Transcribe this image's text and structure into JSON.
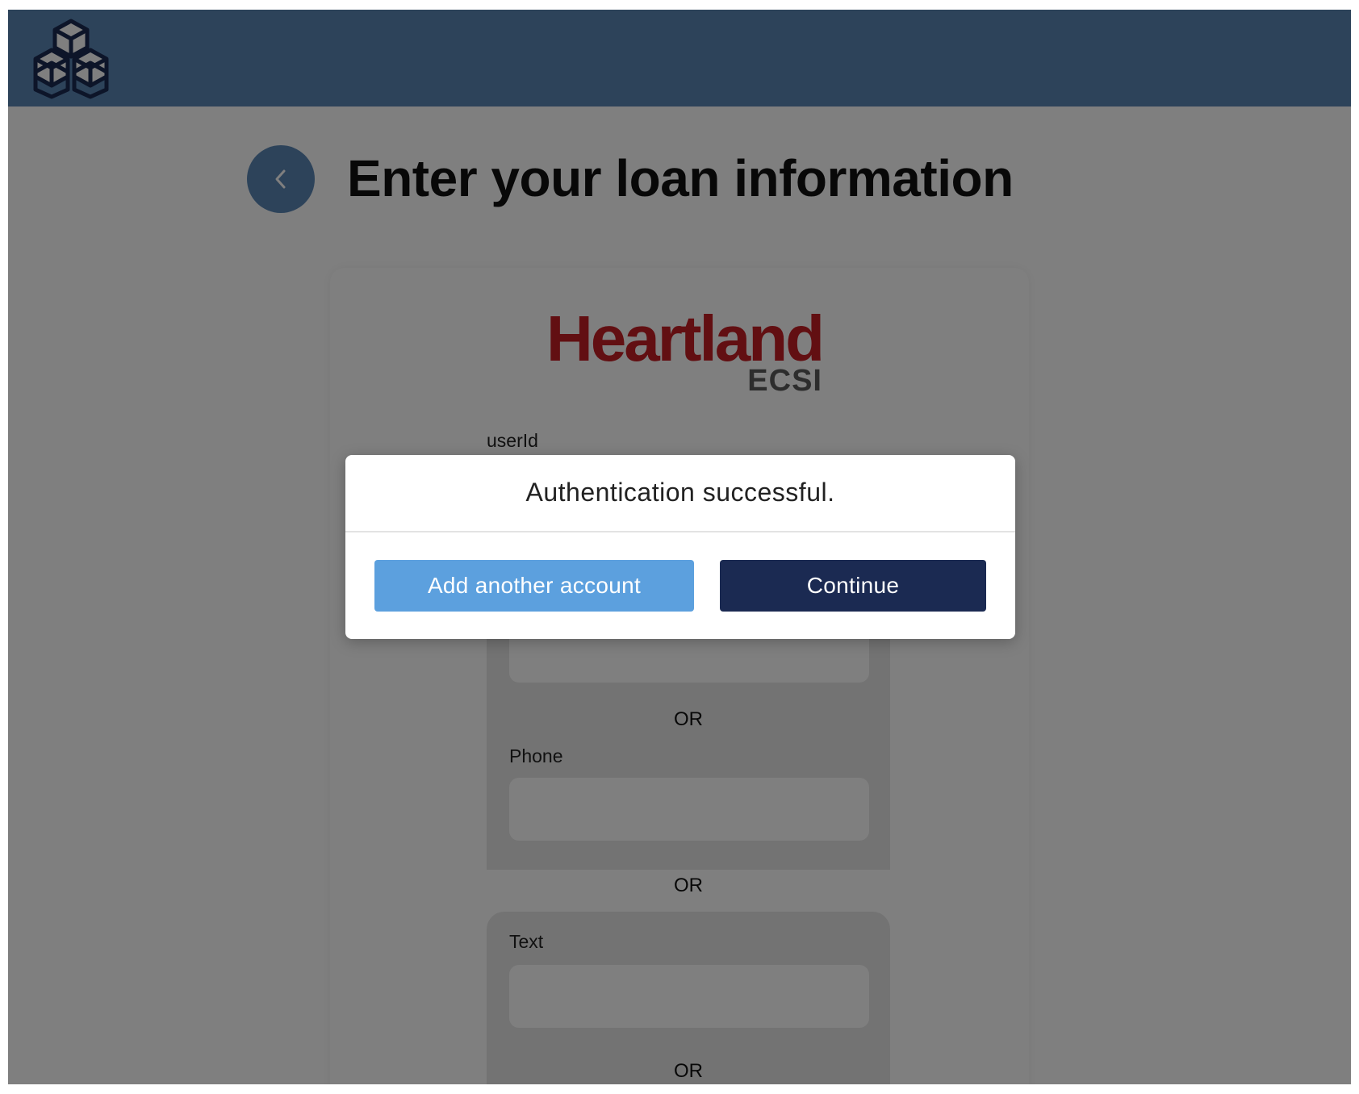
{
  "header": {
    "logo_icon": "stacked-cubes-icon"
  },
  "page": {
    "back_icon": "chevron-left-icon",
    "title": "Enter your loan information"
  },
  "brand": {
    "name": "Heartland",
    "sub": "ECSI",
    "color": "#c41f24"
  },
  "form": {
    "userid_label": "userId",
    "or_label": "OR",
    "phone_label": "Phone",
    "text_label": "Text"
  },
  "modal": {
    "title": "Authentication successful.",
    "add_account_label": "Add another account",
    "continue_label": "Continue"
  },
  "colors": {
    "header": "#5a87b5",
    "primary_button": "#1b2a52",
    "secondary_button": "#5ca0de"
  }
}
